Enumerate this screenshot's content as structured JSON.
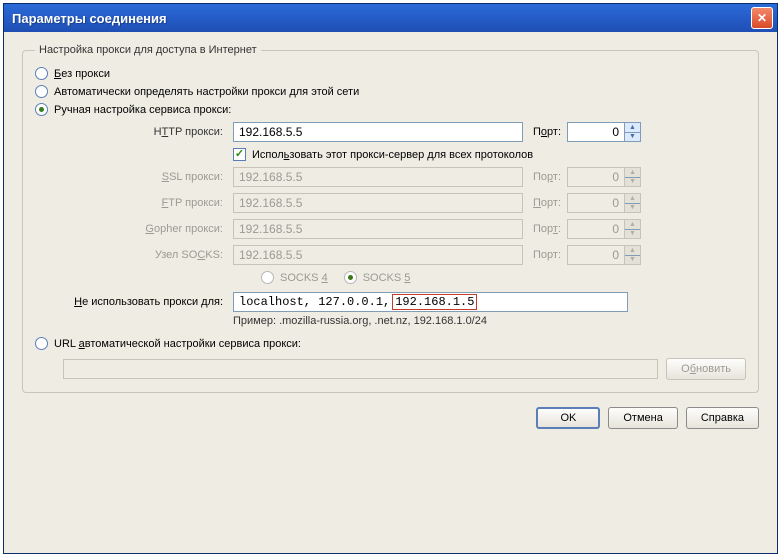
{
  "window": {
    "title": "Параметры соединения"
  },
  "group": {
    "legend": "Настройка прокси для доступа в Интернет"
  },
  "options": {
    "none": "Без прокси",
    "auto": "Автоматически определять настройки прокси для этой сети",
    "manual": "Ручная настройка сервиса прокси:"
  },
  "labels": {
    "http": "HTTP прокси:",
    "ssl": "SSL прокси:",
    "ftp": "FTP прокси:",
    "gopher": "Gopher прокси:",
    "socks": "Узел SOCKS:",
    "port": "Порт:",
    "use_all": "Использовать этот прокси-сервер для всех протоколов",
    "socks4": "SOCKS 4",
    "socks5": "SOCKS 5",
    "noproxy": "Не использовать прокси для:",
    "example": "Пример: .mozilla-russia.org, .net.nz, 192.168.1.0/24",
    "autourl": "URL автоматической настройки сервиса прокси:"
  },
  "values": {
    "http_addr": "192.168.5.5",
    "http_port": "0",
    "ssl_addr": "192.168.5.5",
    "ssl_port": "0",
    "ftp_addr": "192.168.5.5",
    "ftp_port": "0",
    "gopher_addr": "192.168.5.5",
    "gopher_port": "0",
    "socks_addr": "192.168.5.5",
    "socks_port": "0",
    "noproxy_a": "localhost, 127.0.0.1,",
    "noproxy_b": "192.168.1.5",
    "autourl": ""
  },
  "buttons": {
    "reload": "Обновить",
    "ok": "OK",
    "cancel": "Отмена",
    "help": "Справка"
  }
}
